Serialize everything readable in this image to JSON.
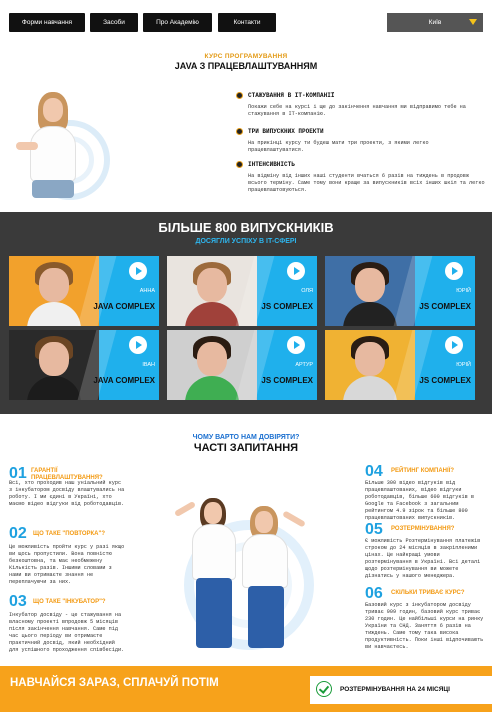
{
  "nav": {
    "items": [
      "Форми навчання",
      "Засоби",
      "Про Академію",
      "Контакти"
    ],
    "city": "Київ"
  },
  "course": {
    "subtitle": "КУРС ПРОГРАМУВАННЯ",
    "title": "JAVA З ПРАЦЕВЛАШТУВАННЯМ",
    "features": [
      {
        "title": "СТАЖУВАННЯ В IT-КОМПАНІЇ",
        "text": "Покажи себе на курсі і ще до закінчення навчання ми відправимо тебе на стажування в IT-компанію."
      },
      {
        "title": "ТРИ ВИПУСКНИХ ПРОЕКТИ",
        "text": "На прикінці курсу ти будеш мати три проекти, з якими легко працевлаштуватися."
      },
      {
        "title": "ІНТЕНСИВНІСТЬ",
        "text": "На відміну від інших наші студенти вчаться 6 разів на тиждень в продовж всього терміну. Саме тому вони краще за випускників всіх інших шкіл та легко працевлаштовуються."
      }
    ]
  },
  "graduates": {
    "title": "БІЛЬШЕ 800 ВИПУСКНИКІВ",
    "subtitle": "ДОСЯГЛИ УСПІХУ В IT-СФЕРІ",
    "cards": [
      {
        "name": "АННА",
        "program": "JAVA COMPLEX"
      },
      {
        "name": "ОЛЯ",
        "program": "JS COMPLEX"
      },
      {
        "name": "ЮРІЙ",
        "program": "JS COMPLEX"
      },
      {
        "name": "ІВАН",
        "program": "JAVA COMPLEX"
      },
      {
        "name": "АРТУР",
        "program": "JS COMPLEX"
      },
      {
        "name": "ЮРІЙ",
        "program": "JS COMPLEX"
      }
    ]
  },
  "faq": {
    "subtitle": "ЧОМУ ВАРТО НАМ ДОВІРЯТИ?",
    "title": "ЧАСТІ ЗАПИТАННЯ",
    "items": [
      {
        "num": "01",
        "q": "ГАРАНТІЇ ПРАЦЕВЛАШТУВАННЯ?",
        "a": "Всі, хто проходив наш уніальний курс з інкубатором досвіду влаштувались на роботу. І ми єдині в Україні, хто маємо відео відгуки від роботодавців."
      },
      {
        "num": "02",
        "q": "ЩО ТАКЕ \"ПОВТОРКА\"?",
        "a": "Це можливість пройти курс у разі якщо ви щось пропустили. Вона повністю безкоштовна, та має необмежену Кількість разів. Іншими словами з нами ви отримаєте знання не переплачуючи за них."
      },
      {
        "num": "03",
        "q": "ЩО ТАКЕ \"ІНКУБАТОР\"?",
        "a": "Інкубатор досвіду - це стажування на власному проекті впродовж 5 місяців після закінчення навчання. Саме під час цього періоду ви отримаєте практичний досвід, який необхідний для успішного проходження співбесіди."
      },
      {
        "num": "04",
        "q": "РЕЙТИНГ КОМПАНІЇ?",
        "a": "Більше 300 відео відгуків від працевлаштованих, відео відгуки роботодавців, більше 600 відгуків в Google та Facebook з загальним рейтингом 4.9 зірок та більше 800 працевлаштованих випускників."
      },
      {
        "num": "05",
        "q": "РОЗТЕРМІНУВАННЯ?",
        "a": "Є можливість Розтермінування платежів строком до 24 місяців в закріпленими цінах. Це найкращі умови розтермінування в Україні. Всі деталі щодо розтермінування ви можете дізнатись у нашого менеджера."
      },
      {
        "num": "06",
        "q": "СКІЛЬКИ ТРИВАЄ КУРС?",
        "a": "Базовий курс з інкубатором досвіду триває 909 годин, базовий курс триває 230 годин. Це найбільші курси на ринку України та СНД. Заняття 6 разів на тиждень. Саме тому така висока продуктивність. Поки інші відпочивають ви навчаєтесь."
      }
    ]
  },
  "cta": {
    "left": "НАВЧАЙСЯ ЗАРАЗ, СПЛАЧУЙ ПОТІМ",
    "right": "РОЗТЕРМІНУВАННЯ НА 24 МІСЯЦІ"
  }
}
